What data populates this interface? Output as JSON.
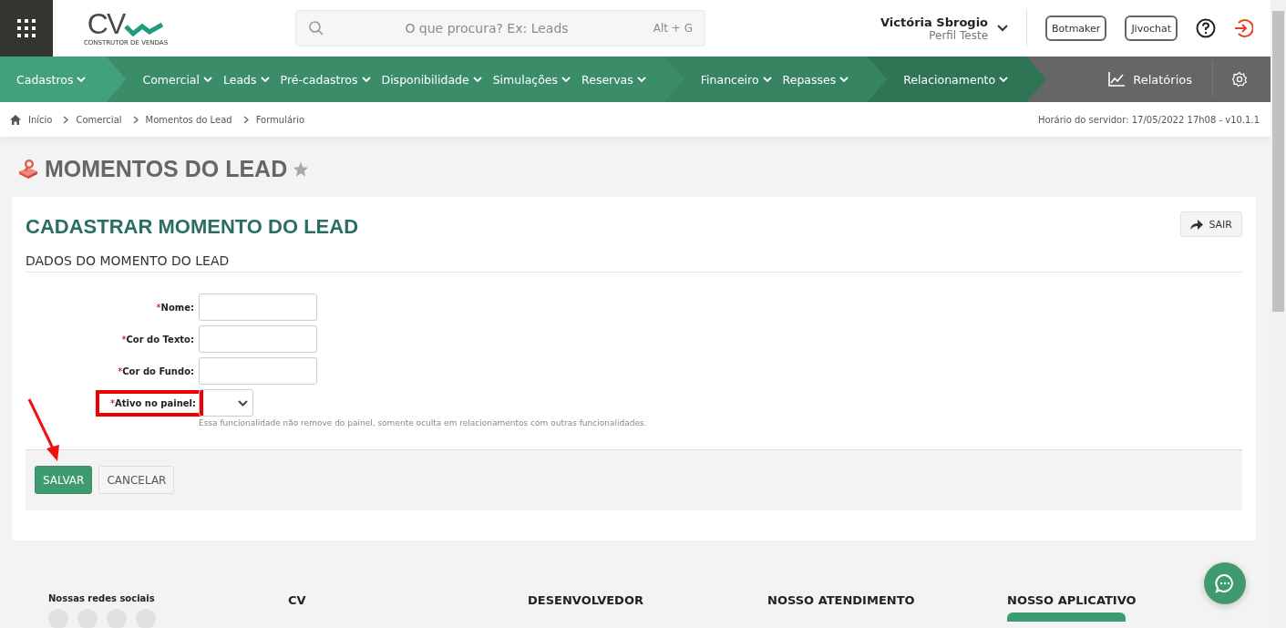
{
  "logo": {
    "wordmark": "CV",
    "tagline": "CONSTRUTOR DE VENDAS"
  },
  "search": {
    "placeholder": "O que procura? Ex: Leads",
    "shortcut": "Alt + G"
  },
  "user": {
    "name": "Victória Sbrogio",
    "profile": "Perfil Teste"
  },
  "header_buttons": [
    "Botmaker",
    "Jivochat"
  ],
  "nav": {
    "sections": [
      {
        "color": "#42a07a",
        "items": [
          "Cadastros"
        ]
      },
      {
        "color": "#3b8d69",
        "items": [
          "Comercial",
          "Leads",
          "Pré-cadastros",
          "Disponibilidade",
          "Simulações",
          "Reservas"
        ]
      },
      {
        "color": "#378462",
        "items": [
          "Financeiro",
          "Repasses"
        ]
      },
      {
        "color": "#2e7455",
        "items": [
          "Relacionamento"
        ]
      }
    ],
    "reports": "Relatórios"
  },
  "breadcrumb": [
    "Início",
    "Comercial",
    "Momentos do Lead",
    "Formulário"
  ],
  "server_time": "Horário do servidor: 17/05/2022 17h08 - v10.1.1",
  "page_title": "MOMENTOS DO LEAD",
  "form": {
    "title": "CADASTRAR MOMENTO DO LEAD",
    "exit_button": "SAIR",
    "section_title": "DADOS DO MOMENTO DO LEAD",
    "required_mark": "*",
    "fields": [
      {
        "label": "Nome:",
        "required": true,
        "kind": "text",
        "highlighted": false
      },
      {
        "label": "Cor do Texto:",
        "required": true,
        "kind": "text",
        "highlighted": false
      },
      {
        "label": "Cor do Fundo:",
        "required": true,
        "kind": "text",
        "highlighted": false
      },
      {
        "label": "Ativo no painel:",
        "required": true,
        "kind": "select",
        "highlighted": true
      }
    ],
    "hint": "Essa funcionalidade não remove do painel, somente oculta em relacionamentos com outras funcionalidades.",
    "buttons": [
      {
        "label": "SALVAR",
        "kind": "primary"
      },
      {
        "label": "CANCELAR",
        "kind": "default"
      }
    ]
  },
  "footer": {
    "columns": [
      "Nossas redes sociais",
      "CV",
      "DESENVOLVEDOR",
      "NOSSO ATENDIMENTO",
      "NOSSO APLICATIVO"
    ]
  }
}
